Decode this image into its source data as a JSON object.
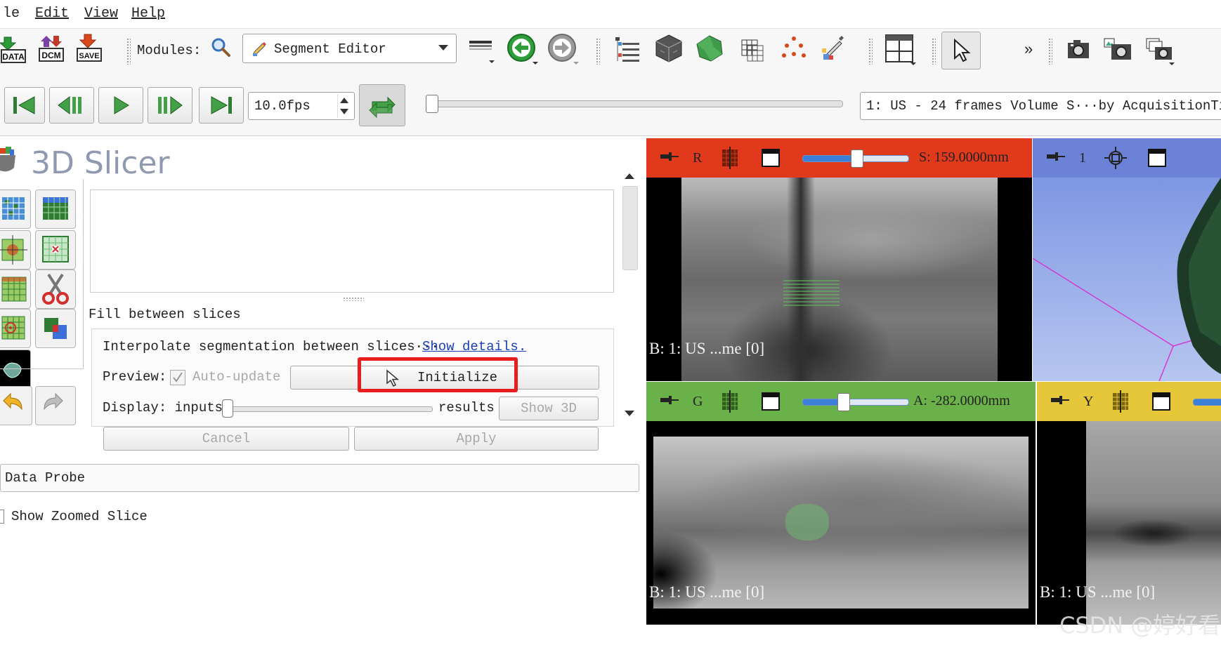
{
  "menu": {
    "file_partial": "le",
    "edit": "Edit",
    "view": "View",
    "help": "Help"
  },
  "toolbar": {
    "modules_label": "Modules:",
    "module_selected": "Segment Editor",
    "icons": {
      "data": "DATA",
      "dcm": "DCM",
      "save": "SAVE"
    },
    "overflow": "»"
  },
  "sequence": {
    "fps": "10.0fps",
    "browser": "1: US - 24 frames Volume S···by AcquisitionTime",
    "progress": 0
  },
  "app": {
    "title": "3D Slicer"
  },
  "segment_editor": {
    "section_title": "Fill between slices",
    "description": "Interpolate segmentation between slices···",
    "show_details": "Show details.",
    "preview_label": "Preview:",
    "auto_update": "Auto-update",
    "initialize": "Initialize",
    "display_label": "Display: inputs",
    "results_label": "results",
    "show3d": "Show 3D",
    "cancel": "Cancel",
    "apply": "Apply",
    "display_slider_value": 0
  },
  "data_probe": {
    "title": "Data Probe",
    "show_zoomed": "Show Zoomed Slice"
  },
  "views": {
    "red": {
      "letter": "R",
      "offset": "S: 159.0000mm",
      "slider_value": 0.5,
      "caption": "B: 1: US ...me [0]",
      "color": "#e23c1e"
    },
    "threed": {
      "letter": "1",
      "color": "#6b82d6"
    },
    "green": {
      "letter": "G",
      "offset": "A: -282.0000mm",
      "slider_value": 0.38,
      "caption": "B: 1: US ...me [0]",
      "color": "#6bb14a"
    },
    "yellow": {
      "letter": "Y",
      "caption": "B: 1: US ...me [0]",
      "color": "#e6c73a"
    }
  },
  "watermark": "CSDN @婷好看"
}
